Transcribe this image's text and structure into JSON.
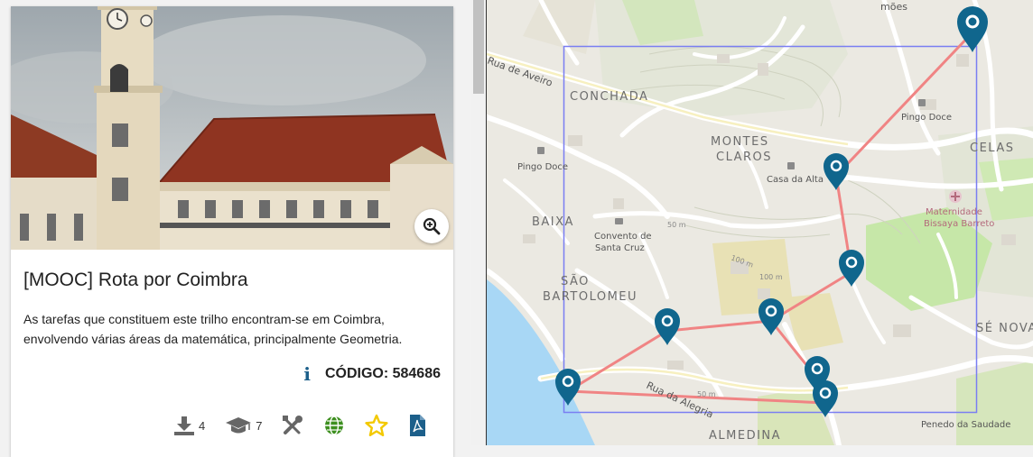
{
  "card": {
    "title": "[MOOC] Rota por Coimbra",
    "description": "As tarefas que constituem este trilho encontram-se em Coimbra, envolvendo várias áreas da matemática, principalmente Geometria.",
    "code_label": "CÓDIGO: 584686",
    "download_count": "4",
    "graduate_count": "7"
  },
  "icons": {
    "zoom": "zoom-in-icon",
    "info": "info-icon",
    "download": "download-icon",
    "graduate": "graduation-cap-icon",
    "tools": "tools-icon",
    "globe": "globe-icon",
    "star": "star-icon",
    "pdf": "pdf-icon"
  },
  "colors": {
    "primary": "#1c5f8a",
    "marker": "#10668d",
    "route": "#f08484",
    "bbox": "#7a7ef2",
    "star": "#f3c900",
    "globe": "#3d8f1f",
    "river": "#a8d7f5",
    "park": "#c6e7a8"
  },
  "map": {
    "labels": {
      "conchada": "CONCHADA",
      "montes": "MONTES",
      "claros": "CLAROS",
      "celas": "CELAS",
      "baixa": "BAIXA",
      "sao": "SÃO",
      "bartolomeu": "BARTOLOMEU",
      "se_nova": "SÉ NOVA",
      "almedina": "ALMEDINA",
      "rua_aveiro": "Rua de Aveiro",
      "rua_alegria": "Rua da Alegria",
      "pingo_doce_1": "Pingo Doce",
      "pingo_doce_2": "Pingo Doce",
      "casa_alta": "Casa da Alta",
      "maternidade": "Maternidade",
      "bissaya": "Bissaya Barreto",
      "convento_1": "Convento de",
      "convento_2": "Santa Cruz",
      "penedo": "Penedo da Saudade",
      "contour_1": "50 m",
      "contour_2": "50 m",
      "contour_3": "100 m",
      "contour_4": "100 m",
      "mhoes": "mões"
    }
  }
}
